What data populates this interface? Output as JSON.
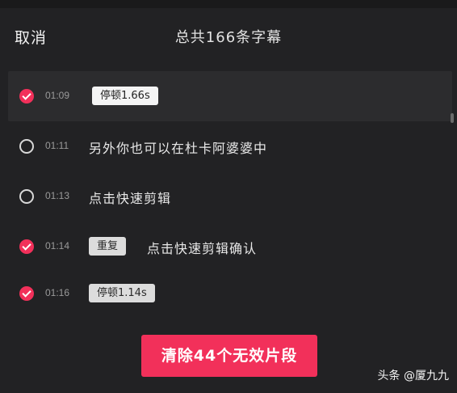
{
  "header": {
    "cancel_label": "取消",
    "title": "总共166条字幕"
  },
  "rows": [
    {
      "time": "01:09",
      "checked": true,
      "tag": "停顿1.66s",
      "tag_style": "light",
      "text": ""
    },
    {
      "time": "01:11",
      "checked": false,
      "tag": "",
      "tag_style": "",
      "text": "另外你也可以在杜卡阿婆婆中"
    },
    {
      "time": "01:13",
      "checked": false,
      "tag": "",
      "tag_style": "",
      "text": "点击快速剪辑"
    },
    {
      "time": "01:14",
      "checked": true,
      "tag": "重复",
      "tag_style": "grey",
      "text": "点击快速剪辑确认"
    },
    {
      "time": "01:16",
      "checked": true,
      "tag": "停顿1.14s",
      "tag_style": "grey",
      "text": ""
    }
  ],
  "action": {
    "clear_label": "清除44个无效片段"
  },
  "watermark": "头条 @厦九九",
  "colors": {
    "accent": "#f2305a",
    "background": "#222224"
  }
}
